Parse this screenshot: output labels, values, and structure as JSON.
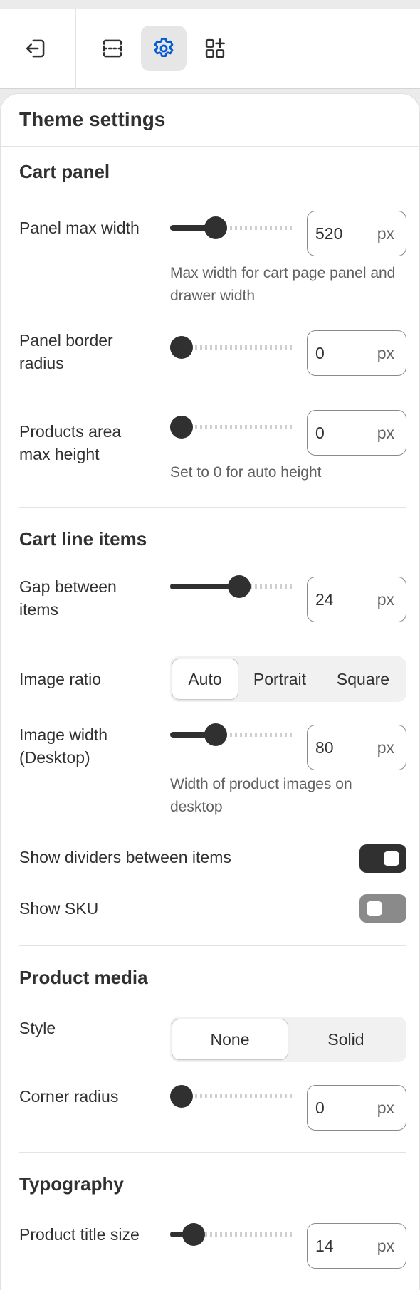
{
  "toolbar": {
    "exit_icon": "exit-icon",
    "sections_icon": "sections-icon",
    "settings_icon": "gear-icon",
    "apps_icon": "add-block-icon",
    "accent_color": "#005bd3"
  },
  "panel": {
    "title": "Theme settings"
  },
  "cart_panel": {
    "title": "Cart panel",
    "max_width": {
      "label": "Panel max width",
      "value": "520",
      "unit": "px",
      "level": 0.33,
      "help": "Max width for cart page panel and drawer width"
    },
    "border_radius": {
      "label": "Panel border radius",
      "value": "0",
      "unit": "px",
      "level": 0.0
    },
    "products_max_height": {
      "label": "Products area max height",
      "value": "0",
      "unit": "px",
      "level": 0.0,
      "help": "Set to 0 for auto height"
    }
  },
  "cart_line_items": {
    "title": "Cart line items",
    "gap": {
      "label": "Gap between items",
      "value": "24",
      "unit": "px",
      "level": 0.56
    },
    "image_ratio": {
      "label": "Image ratio",
      "options": [
        "Auto",
        "Portrait",
        "Square"
      ],
      "selected": "Auto"
    },
    "image_width": {
      "label": "Image width (Desktop)",
      "value": "80",
      "unit": "px",
      "level": 0.33,
      "help": "Width of product images on desktop"
    },
    "show_dividers": {
      "label": "Show dividers between items",
      "on": true
    },
    "show_sku": {
      "label": "Show SKU",
      "on": false
    }
  },
  "product_media": {
    "title": "Product media",
    "style": {
      "label": "Style",
      "options": [
        "None",
        "Solid"
      ],
      "selected": "None"
    },
    "corner_radius": {
      "label": "Corner radius",
      "value": "0",
      "unit": "px",
      "level": 0.0
    }
  },
  "typography": {
    "title": "Typography",
    "product_title_size": {
      "label": "Product title size",
      "value": "14",
      "unit": "px",
      "level": 0.12
    }
  }
}
